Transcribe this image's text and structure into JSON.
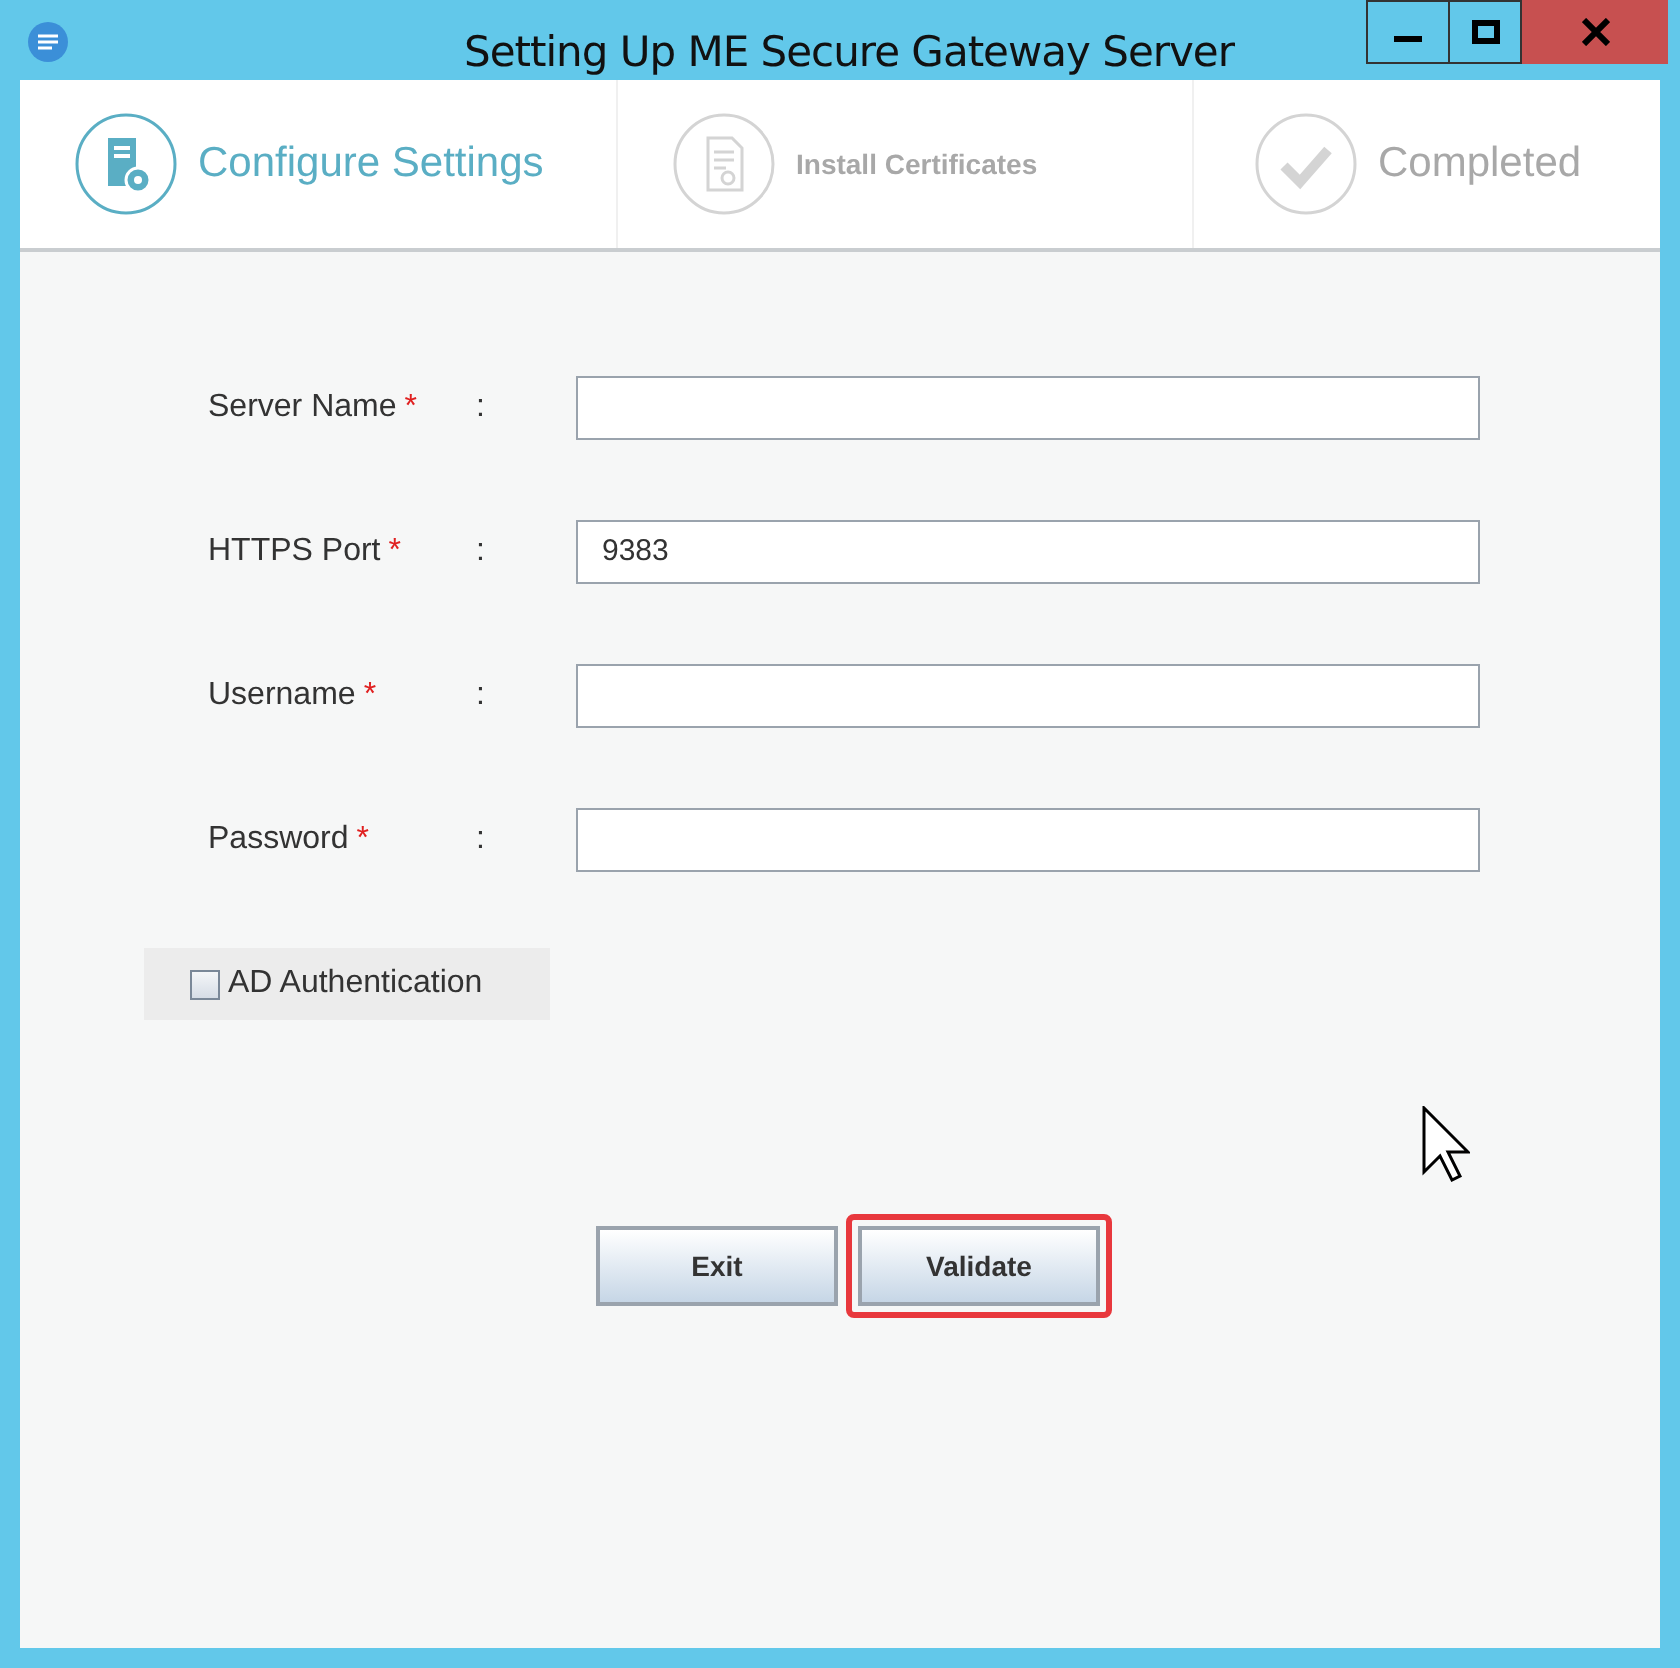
{
  "window": {
    "title": "Setting Up ME Secure Gateway Server"
  },
  "steps": [
    {
      "label": "Configure Settings",
      "kind": "settings",
      "selected": true
    },
    {
      "label": "Install Certificates",
      "kind": "certificate",
      "selected": false
    },
    {
      "label": "Completed",
      "kind": "check",
      "selected": false
    }
  ],
  "fields": [
    {
      "label": "Server Name",
      "required": "*",
      "separator": ":"
    },
    {
      "label": "HTTPS Port",
      "required": "*",
      "separator": ":",
      "value": "9383"
    },
    {
      "label": "Username",
      "required": "*",
      "separator": ":"
    },
    {
      "label": "Password",
      "required": "*",
      "separator": ":"
    }
  ],
  "ad_authentication": {
    "label": "AD Authentication",
    "checked": false
  },
  "buttons": [
    {
      "label": "Exit",
      "highlighted": false
    },
    {
      "label": "Validate",
      "highlighted": true
    }
  ]
}
